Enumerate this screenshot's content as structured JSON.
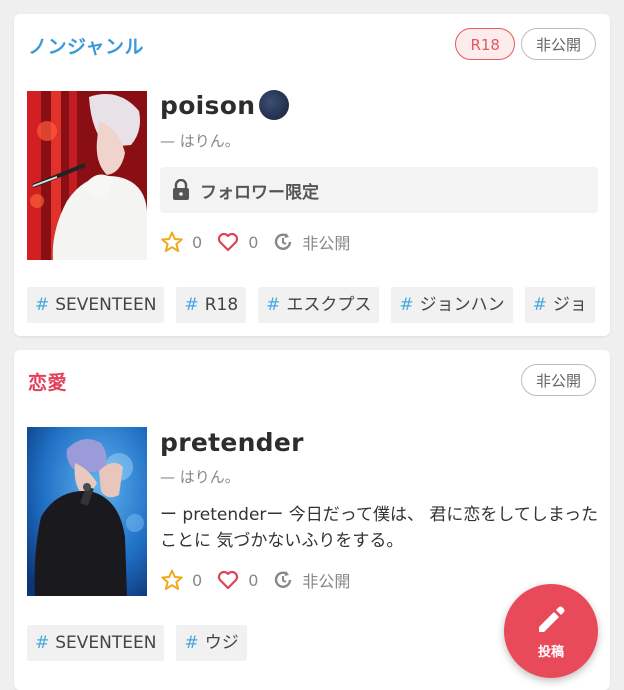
{
  "works": [
    {
      "genre": "ノンジャンル",
      "genre_color": "#3a9ad9",
      "badges": {
        "r18": "R18",
        "private": "非公開"
      },
      "title": "poison",
      "author": "— はりん。",
      "locked_text": "フォロワー限定",
      "stars": "0",
      "hearts": "0",
      "status": "非公開",
      "tags": [
        "SEVENTEEN",
        "R18",
        "エスクプス",
        "ジョンハン",
        "ジョ"
      ]
    },
    {
      "genre": "恋愛",
      "genre_color": "#e2415a",
      "badges": {
        "private": "非公開"
      },
      "title": "pretender",
      "author": "— はりん。",
      "description": "ー pretenderー 今日だって僕は、 君に恋をしてしまったことに 気づかないふりをする。",
      "stars": "0",
      "hearts": "0",
      "status": "非公開",
      "tags": [
        "SEVENTEEN",
        "ウジ"
      ]
    }
  ],
  "fab": {
    "label": "投稿",
    "icon": "pencil-icon"
  },
  "icons": [
    "star-icon",
    "heart-icon",
    "history-icon",
    "lock-icon",
    "moon-icon"
  ]
}
